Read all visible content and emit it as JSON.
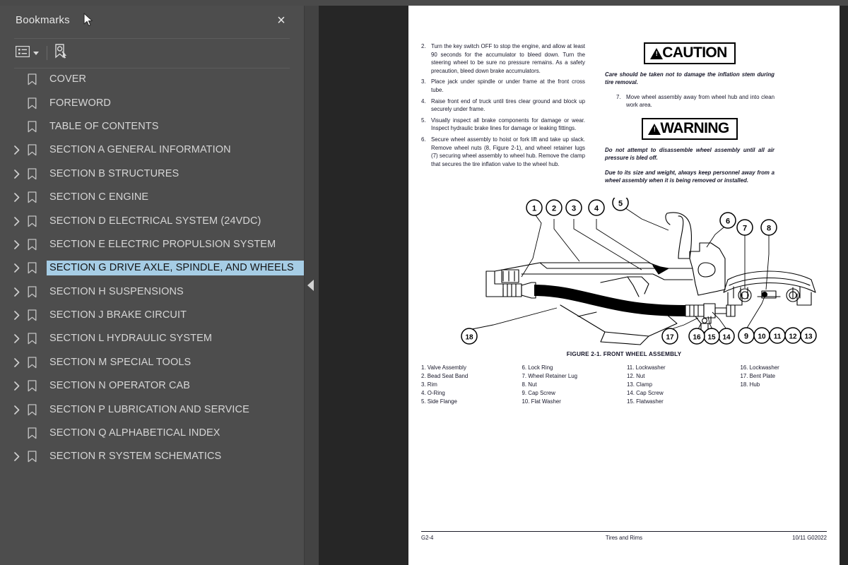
{
  "window": {
    "accent_selection": "#a6cde5",
    "panel_bg": "#4d4d4d",
    "viewport_bg": "#262626"
  },
  "sidebar": {
    "title": "Bookmarks",
    "close_label": "×",
    "toolbar": [
      {
        "name": "bookmark-options-button",
        "icon": "list-options-icon",
        "has_caret": true
      },
      {
        "name": "find-bookmark-button",
        "icon": "bookmark-search-icon",
        "has_caret": false
      }
    ],
    "items": [
      {
        "label": "COVER",
        "expandable": false,
        "selected": false
      },
      {
        "label": "FOREWORD",
        "expandable": false,
        "selected": false
      },
      {
        "label": "TABLE OF CONTENTS",
        "expandable": false,
        "selected": false
      },
      {
        "label": "SECTION A GENERAL INFORMATION",
        "expandable": true,
        "selected": false
      },
      {
        "label": "SECTION B STRUCTURES",
        "expandable": true,
        "selected": false
      },
      {
        "label": "SECTION C ENGINE",
        "expandable": true,
        "selected": false
      },
      {
        "label": "SECTION D ELECTRICAL SYSTEM (24VDC)",
        "expandable": true,
        "selected": false
      },
      {
        "label": "SECTION E ELECTRIC PROPULSION SYSTEM",
        "expandable": true,
        "selected": false
      },
      {
        "label": "SECTION G DRIVE AXLE, SPINDLE, AND WHEELS",
        "expandable": true,
        "selected": true
      },
      {
        "label": "SECTION H SUSPENSIONS",
        "expandable": true,
        "selected": false
      },
      {
        "label": "SECTION J BRAKE CIRCUIT",
        "expandable": true,
        "selected": false
      },
      {
        "label": "SECTION L  HYDRAULIC SYSTEM",
        "expandable": true,
        "selected": false
      },
      {
        "label": "SECTION M SPECIAL TOOLS",
        "expandable": true,
        "selected": false
      },
      {
        "label": "SECTION N OPERATOR CAB",
        "expandable": true,
        "selected": false
      },
      {
        "label": "SECTION P LUBRICATION AND SERVICE",
        "expandable": true,
        "selected": false
      },
      {
        "label": "SECTION Q ALPHABETICAL INDEX",
        "expandable": false,
        "selected": false
      },
      {
        "label": "SECTION R SYSTEM SCHEMATICS",
        "expandable": true,
        "selected": false
      }
    ]
  },
  "document": {
    "steps_left": [
      {
        "num": "2.",
        "text": "Turn the key switch OFF to stop the engine, and allow at least 90 seconds for the accumulator to bleed down. Turn the steering wheel to be sure no pressure remains. As a safety precaution, bleed down brake accumulators."
      },
      {
        "num": "3.",
        "text": "Place jack under spindle or under frame at the front cross tube."
      },
      {
        "num": "4.",
        "text": "Raise front end of truck until tires clear ground and block up securely under frame."
      },
      {
        "num": "5.",
        "text": "Visually inspect all brake components for damage or wear. Inspect hydraulic brake lines for damage or leaking fittings."
      },
      {
        "num": "6.",
        "text": "Secure wheel assembly to hoist or fork lift and take up slack. Remove wheel nuts (8, Figure 2-1), and wheel retainer lugs (7) securing wheel assembly to wheel hub. Remove the clamp that secures the tire inflation valve to the wheel hub."
      }
    ],
    "caution": {
      "word": "CAUTION",
      "text": "Care should be taken not to damage the inflation stem during tire removal."
    },
    "step7": {
      "num": "7.",
      "text": "Move wheel assembly away from wheel hub and into clean work area."
    },
    "warning": {
      "word": "WARNING",
      "text1": "Do not attempt to disassemble wheel assembly until all air pressure is bled off.",
      "text2": "Due to its size and weight, always keep personnel away from a wheel assembly when it is being removed or installed."
    },
    "figure": {
      "caption": "FIGURE 2-1. FRONT WHEEL ASSEMBLY",
      "callouts_main": [
        "1",
        "2",
        "3",
        "4",
        "5",
        "6",
        "14",
        "15",
        "16",
        "17",
        "18"
      ],
      "callouts_detail": [
        "7",
        "8",
        "9",
        "10",
        "11",
        "12",
        "13"
      ],
      "parts": {
        "col1": [
          "1. Valve Assembly",
          "2. Bead Seat Band",
          "3. Rim",
          "4. O-Ring",
          "5. Side Flange"
        ],
        "col2": [
          "6. Lock Ring",
          "7. Wheel Retainer Lug",
          "8. Nut",
          "9. Cap Screw",
          "10. Flat Washer"
        ],
        "col3": [
          "11. Lockwasher",
          "12. Nut",
          "13. Clamp",
          "14. Cap Screw",
          "15. Flatwasher"
        ],
        "col4": [
          "16. Lockwasher",
          "17. Bent Plate",
          "18. Hub"
        ]
      }
    },
    "footer": {
      "left": "G2-4",
      "center": "Tires and Rims",
      "right": "10/11  G02022"
    }
  }
}
